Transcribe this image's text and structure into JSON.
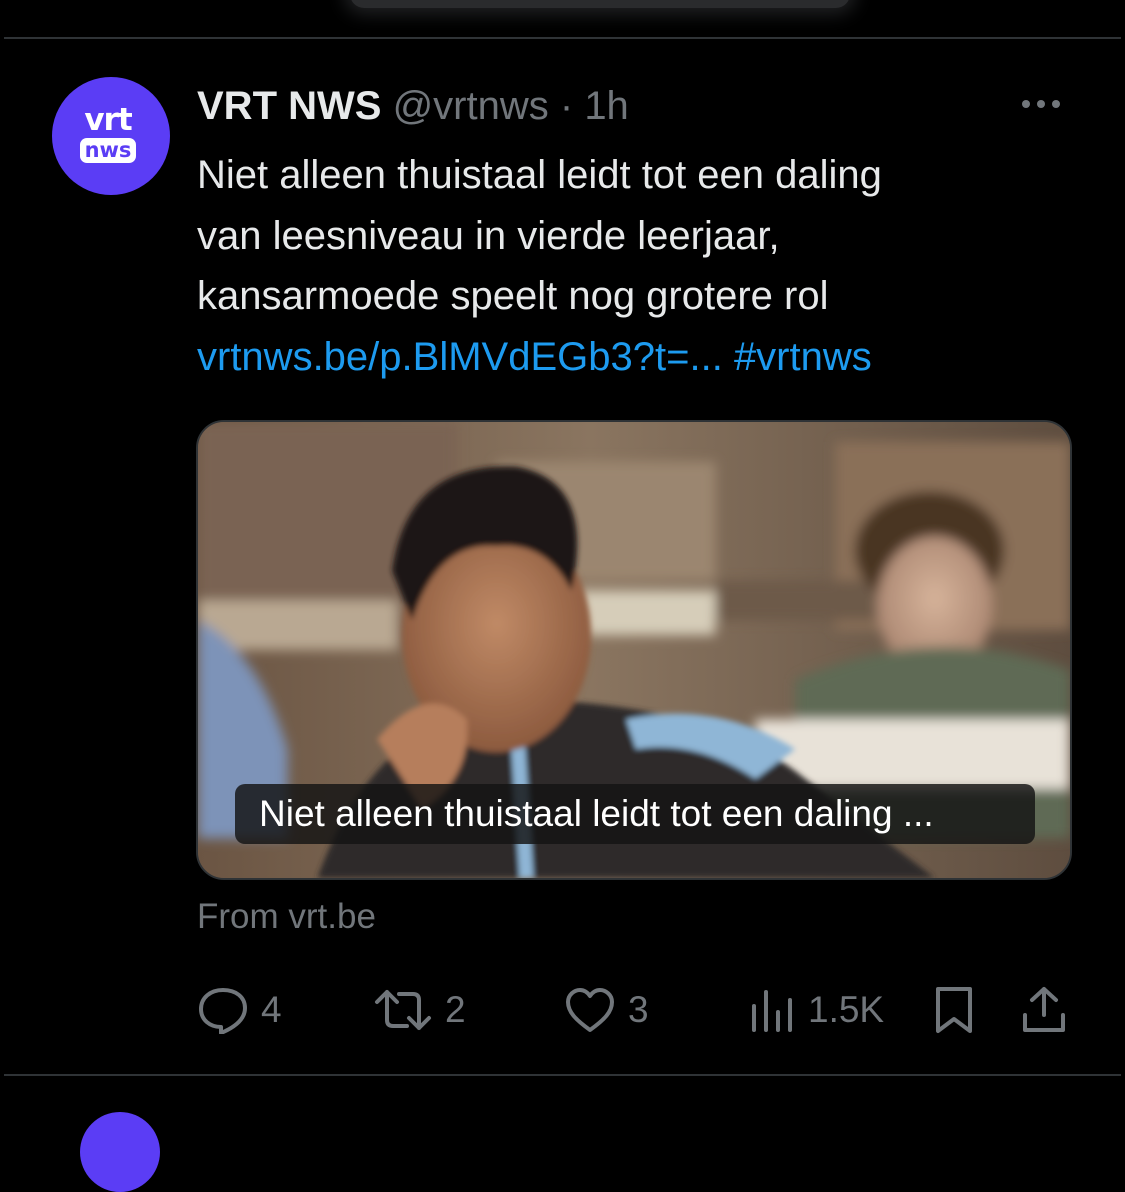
{
  "tweet": {
    "avatar": {
      "logo_top": "vrt",
      "logo_bottom": "nws",
      "color": "#5b3df5"
    },
    "display_name": "VRT NWS",
    "handle": "@vrtnws",
    "separator": "·",
    "time": "1h",
    "text_lines": [
      "Niet alleen thuistaal leidt tot een daling",
      "van leesniveau in vierde leerjaar,",
      "kansarmoede speelt nog grotere rol"
    ],
    "link_text": "vrtnws.be/p.BlMVdEGb3?t=...",
    "hashtag": "#vrtnws",
    "card": {
      "caption": "Niet alleen thuistaal leidt tot een daling ...",
      "source": "From vrt.be"
    },
    "actions": {
      "replies": "4",
      "reposts": "2",
      "likes": "3",
      "views": "1.5K"
    }
  },
  "colors": {
    "background": "#000000",
    "text": "#e7e9ea",
    "muted": "#71767b",
    "link": "#1d9bf0",
    "divider": "#2f3336"
  },
  "icons": {
    "more": "more-horizontal-icon",
    "reply": "reply-icon",
    "repost": "repost-icon",
    "like": "heart-icon",
    "views": "views-icon",
    "bookmark": "bookmark-icon",
    "share": "share-icon"
  }
}
